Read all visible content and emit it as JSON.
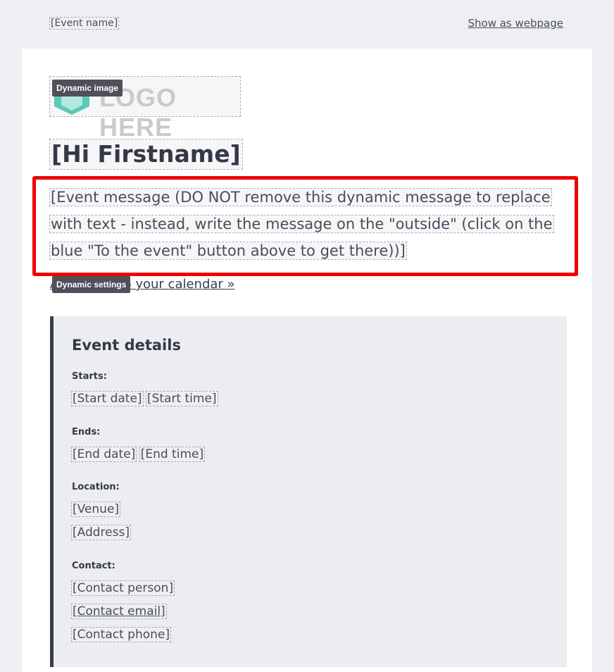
{
  "header": {
    "event_name": "[Event name]",
    "show_webpage": "Show as webpage"
  },
  "logo": {
    "text": "LOGO HERE",
    "tag": "Dynamic image"
  },
  "greeting": "[Hi Firstname]",
  "message": {
    "line1": "[Event message (DO NOT remove this dynamic message to replace",
    "line2": "with text - instead, write the message on the \"outside\" (click on the",
    "line3": "blue \"To the event\" button above to get there))]"
  },
  "calendar": {
    "link": "Add event to your calendar »",
    "tag": "Dynamic settings"
  },
  "details": {
    "title": "Event details",
    "starts_label": "Starts:",
    "start_date": "[Start date]",
    "start_time": "[Start time]",
    "ends_label": "Ends:",
    "end_date": "[End date]",
    "end_time": "[End time]",
    "location_label": "Location:",
    "venue": "[Venue]",
    "address": "[Address]",
    "contact_label": "Contact:",
    "contact_person": "[Contact person]",
    "contact_email": "[Contact email]",
    "contact_phone": "[Contact phone]"
  },
  "colors": {
    "highlight": "#ee0000",
    "logo_accent": "#5cc8b8",
    "tag_bg": "#4f505a"
  }
}
